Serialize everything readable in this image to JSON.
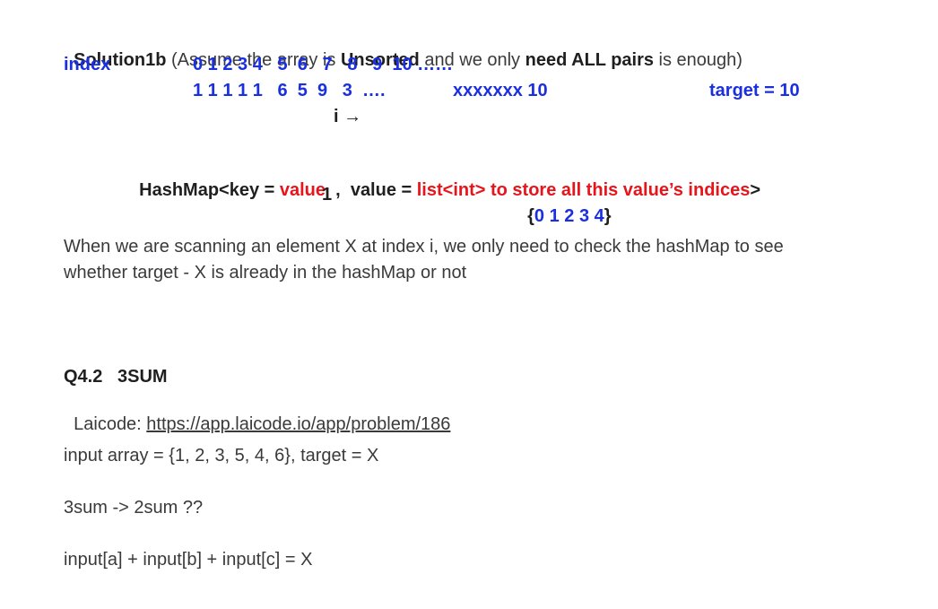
{
  "solution": {
    "heading": "Solution1b",
    "paren_open": " (Assume the array is ",
    "unsorted": "Unsorted",
    "mid": " and we only ",
    "need_all_pairs": "need ALL pairs",
    "tail": " is enough)"
  },
  "array": {
    "index_label": "index",
    "indices": "0 1 2 3 4   5  6   7   8   9  10 ……",
    "values": "1 1 1 1 1   6  5  9   3  ….",
    "values_tail": "xxxxxxx 10",
    "target": "target = 10",
    "pointer": "i →"
  },
  "hashmap": {
    "decl_start": "HashMap<key = ",
    "key_word": "value",
    "sep": "  ,  value = ",
    "list_text": "list<int> to store all this value’s indices",
    "decl_end": ">",
    "example_key": "1",
    "example_value_open": "{",
    "example_value_items": "0 1 2 3 4",
    "example_value_close": "}"
  },
  "explanation": {
    "line1": "When we are scanning an element X at index i, we only need to check the hashMap to see",
    "line2": "whether target - X is already in the hashMap or not"
  },
  "q42": {
    "title": "Q4.2   3SUM",
    "laicode_label": "Laicode: ",
    "laicode_link": "https://app.laicode.io/app/problem/186",
    "input_line": "input array = {1, 2, 3, 5, 4, 6}, target = X",
    "reduction": "3sum -> 2sum ??",
    "equation": "input[a] + input[b] + input[c] = X"
  },
  "colors": {
    "blue": "#1a2fe0",
    "red": "#e8141b",
    "text": "#3a3a3a"
  }
}
